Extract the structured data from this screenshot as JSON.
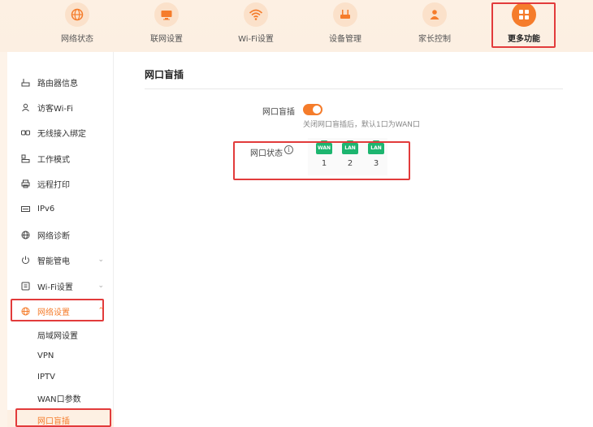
{
  "topnav": {
    "items": [
      {
        "label": "网络状态",
        "icon": "globe-icon"
      },
      {
        "label": "联网设置",
        "icon": "monitor-icon"
      },
      {
        "label": "Wi-Fi设置",
        "icon": "wifi-icon"
      },
      {
        "label": "设备管理",
        "icon": "router-icon"
      },
      {
        "label": "家长控制",
        "icon": "parent-icon"
      },
      {
        "label": "更多功能",
        "icon": "grid-icon",
        "active": true
      }
    ]
  },
  "sidebar": {
    "items": [
      {
        "label": "路由器信息",
        "icon": "router-info-icon"
      },
      {
        "label": "访客Wi-Fi",
        "icon": "guest-icon"
      },
      {
        "label": "无线接入绑定",
        "icon": "link-icon"
      },
      {
        "label": "工作模式",
        "icon": "mode-icon"
      },
      {
        "label": "远程打印",
        "icon": "printer-icon"
      },
      {
        "label": "IPv6",
        "icon": "ipv6-icon"
      },
      {
        "label": "网络诊断",
        "icon": "diagnose-icon"
      },
      {
        "label": "智能管电",
        "icon": "power-icon",
        "expandable": true
      },
      {
        "label": "Wi-Fi设置",
        "icon": "wifi-settings-icon",
        "expandable": true
      },
      {
        "label": "网络设置",
        "icon": "network-icon",
        "active": true
      }
    ],
    "subitems": [
      {
        "label": "局域网设置"
      },
      {
        "label": "VPN"
      },
      {
        "label": "IPTV"
      },
      {
        "label": "WAN口参数"
      },
      {
        "label": "网口盲插",
        "active": true
      }
    ]
  },
  "content": {
    "title": "网口盲插",
    "blind_plug": {
      "label": "网口盲插",
      "enabled": true,
      "hint": "关闭网口盲插后，默认1口为WAN口"
    },
    "port_status": {
      "label": "网口状态",
      "info_symbol": "i",
      "ports": [
        {
          "type": "WAN",
          "number": "1"
        },
        {
          "type": "LAN",
          "number": "2"
        },
        {
          "type": "LAN",
          "number": "3"
        }
      ]
    }
  },
  "colors": {
    "accent": "#f57c2b",
    "highlight": "#e23b3b",
    "port_green": "#1db56f"
  }
}
